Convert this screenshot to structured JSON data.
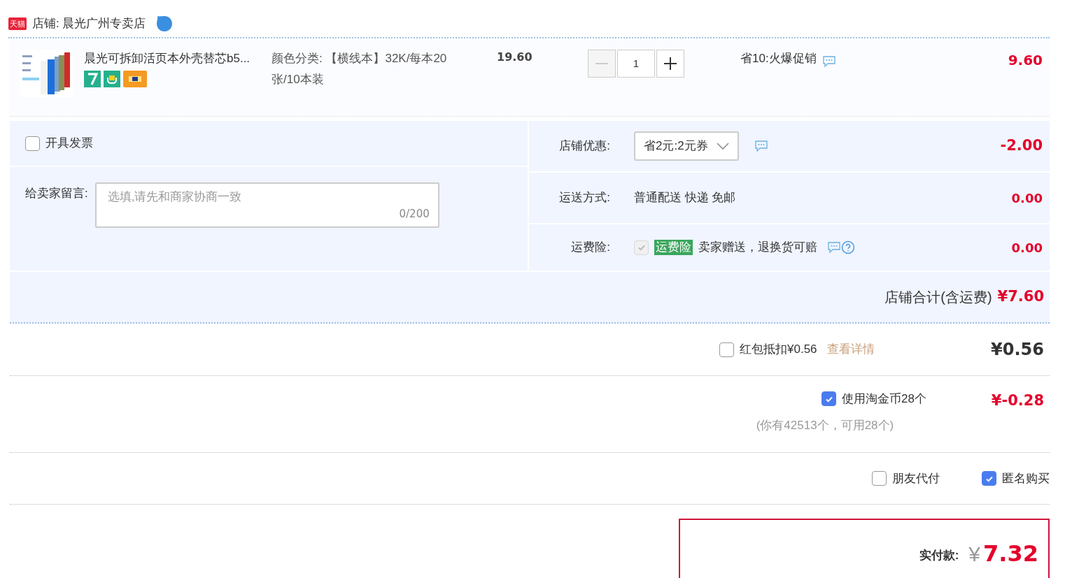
{
  "shop": {
    "platform_badge": "天猫",
    "label": "店铺: 晨光广州专卖店"
  },
  "item": {
    "title": "晨光可拆卸活页本外壳替芯b5...",
    "spec": "颜色分类: 【横线本】32K/每本20张/10本装",
    "unit_price": "19.60",
    "quantity": "1",
    "minus_disabled": true,
    "promotion": "省10:火爆促销",
    "subtotal": "9.60"
  },
  "invoice": {
    "label": "开具发票",
    "checked": false
  },
  "message": {
    "label": "给卖家留言:",
    "placeholder": "选填,请先和商家协商一致",
    "counter": "0/200"
  },
  "options": [
    {
      "kind": "select",
      "label": "店铺优惠:",
      "value": "省2元:2元券",
      "amount": "-2.00"
    },
    {
      "kind": "text",
      "label": "运送方式:",
      "value": "普通配送 快递 免邮",
      "amount": "0.00"
    },
    {
      "kind": "insurance",
      "label": "运费险:",
      "checked": true,
      "disabled": true,
      "tag": "运费险",
      "value": "卖家赠送，退换货可赔",
      "amount": "0.00"
    }
  ],
  "shop_total": {
    "label": "店铺合计(含运费)",
    "amount": "¥7.60"
  },
  "red_packet": {
    "label": "红包抵扣¥0.56",
    "checked": false,
    "link": "查看详情",
    "amount": "¥0.56"
  },
  "coins": {
    "label": "使用淘金币28个",
    "checked": true,
    "note": "(你有42513个，可用28个)",
    "amount": "¥-0.28"
  },
  "extras": [
    {
      "label": "朋友代付",
      "checked": false
    },
    {
      "label": "匿名购买",
      "checked": true
    }
  ],
  "payment": {
    "label": "实付款:",
    "currency": "¥",
    "amount": "7.32"
  }
}
